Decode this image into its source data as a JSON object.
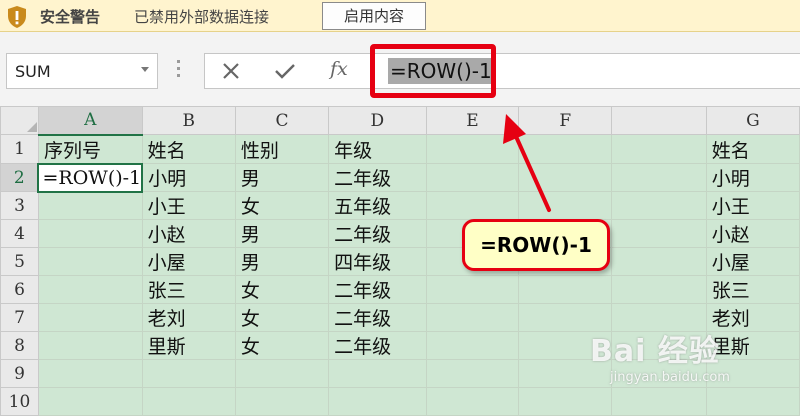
{
  "security_bar": {
    "title": "安全警告",
    "message": "已禁用外部数据连接",
    "button_label": "启用内容"
  },
  "formula_bar": {
    "name_box_value": "SUM",
    "cancel_icon": "close-icon",
    "confirm_icon": "check-icon",
    "fx_label": "fx",
    "formula": "=ROW()-1"
  },
  "columns": [
    "A",
    "B",
    "C",
    "D",
    "E",
    "F",
    "G"
  ],
  "rows": [
    "1",
    "2",
    "3",
    "4",
    "5",
    "6",
    "7",
    "8",
    "9",
    "10"
  ],
  "cells": [
    [
      "序列号",
      "姓名",
      "性别",
      "年级",
      "",
      "",
      "姓名"
    ],
    [
      "=ROW()-1",
      "小明",
      "男",
      "二年级",
      "",
      "",
      "小明"
    ],
    [
      "",
      "小王",
      "女",
      "五年级",
      "",
      "",
      "小王"
    ],
    [
      "",
      "小赵",
      "男",
      "二年级",
      "",
      "",
      "小赵"
    ],
    [
      "",
      "小屋",
      "男",
      "四年级",
      "",
      "",
      "小屋"
    ],
    [
      "",
      "张三",
      "女",
      "二年级",
      "",
      "",
      "张三"
    ],
    [
      "",
      "老刘",
      "女",
      "二年级",
      "",
      "",
      "老刘"
    ],
    [
      "",
      "里斯",
      "女",
      "二年级",
      "",
      "",
      "里斯"
    ],
    [
      "",
      "",
      "",
      "",
      "",
      "",
      ""
    ],
    [
      "",
      "",
      "",
      "",
      "",
      "",
      ""
    ]
  ],
  "active_cell": "A2",
  "callout": {
    "text": "=ROW()-1"
  },
  "watermark": {
    "main": "Bai 经验",
    "sub": "jingyan.baidu.com"
  },
  "colors": {
    "accent_red": "#e60012",
    "sheet_green": "#cfe7d3",
    "excel_green": "#217346",
    "security_bar": "#fff4ce",
    "callout_fill": "#ffffc6"
  }
}
